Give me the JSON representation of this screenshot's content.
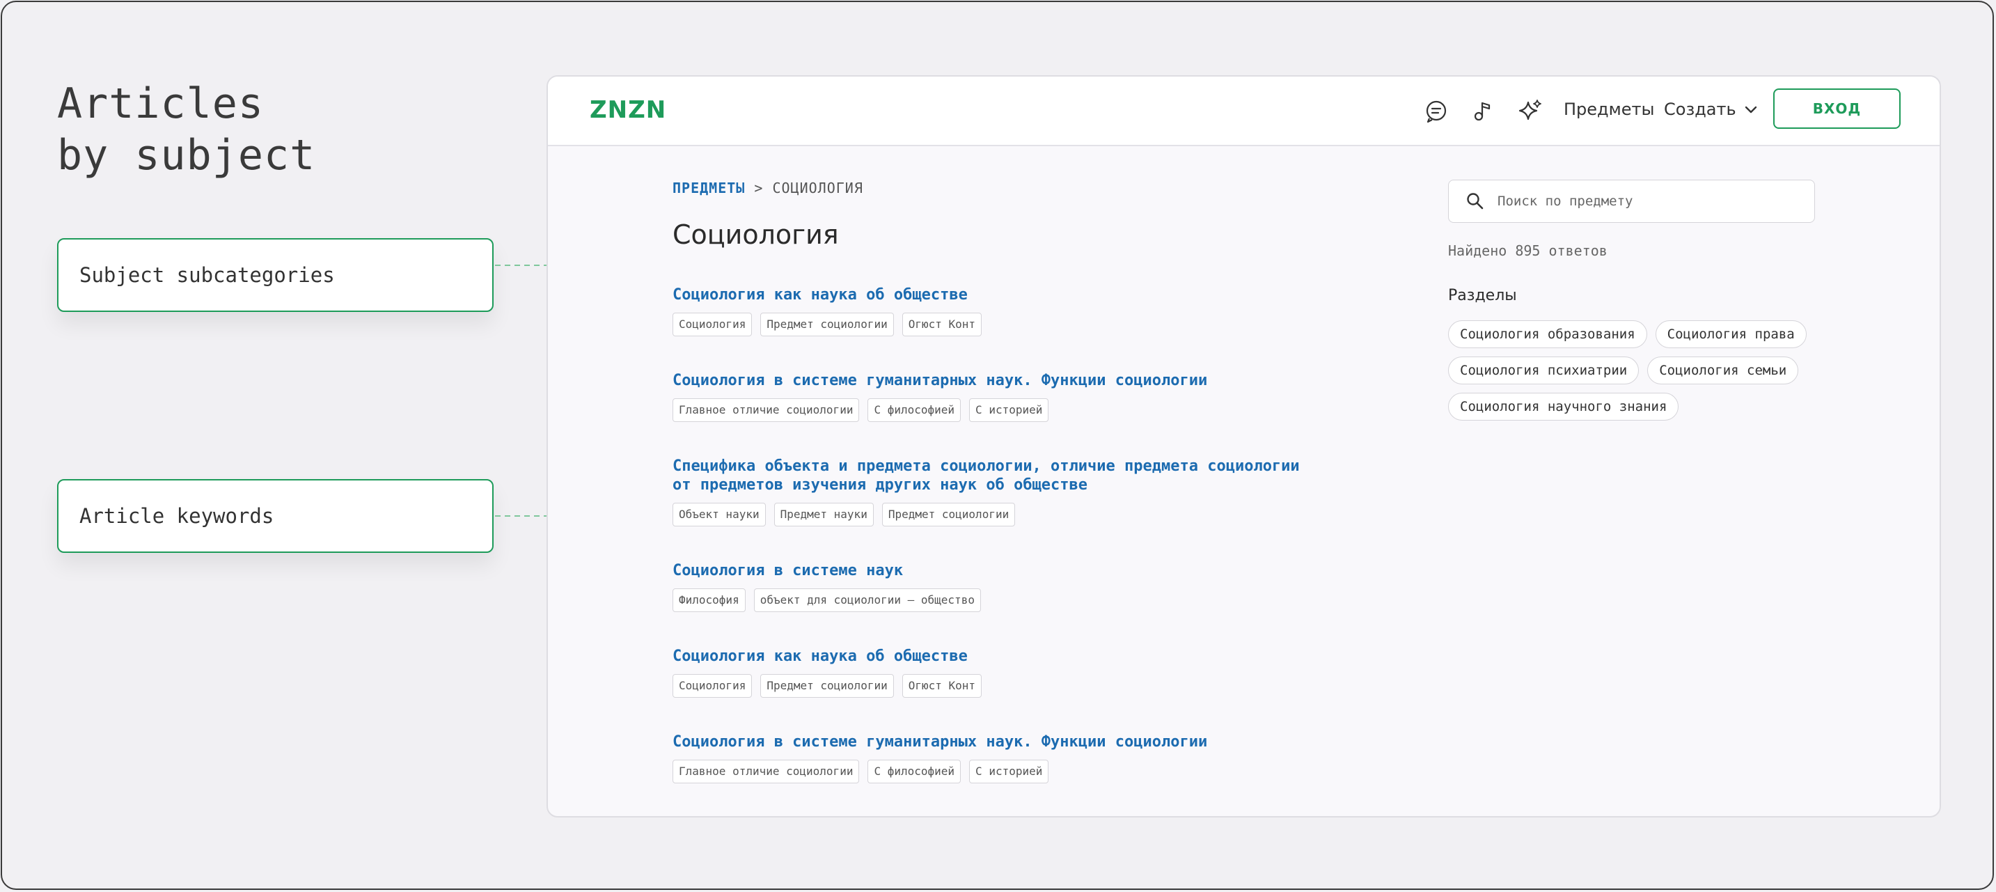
{
  "annotations": {
    "heading_line1": "Articles",
    "heading_line2": "by subject",
    "callout_subcategories": "Subject subcategories",
    "callout_keywords": "Article keywords"
  },
  "header": {
    "logo": "ZNZN",
    "icons": [
      "chat-icon",
      "music-note-icon",
      "sparkle-icon",
      "chevron-down-icon"
    ],
    "nav_subjects": "Предметы",
    "nav_create": "Создать",
    "login": "ВХОД"
  },
  "breadcrumb": {
    "link": "ПРЕДМЕТЫ",
    "separator": ">",
    "current": "СОЦИОЛОГИЯ"
  },
  "page_title": "Социология",
  "articles": [
    {
      "title": "Социология как наука об обществе",
      "tags": [
        "Социология",
        "Предмет социологии",
        "Огюст Конт"
      ]
    },
    {
      "title": "Социология в системе гуманитарных наук. Функции социологии",
      "tags": [
        "Главное отличие социологии",
        "С философией",
        "С историей"
      ]
    },
    {
      "title": "Специфика объекта и предмета социологии, отличие предмета социологии",
      "title2": "от предметов изучения других наук об обществе",
      "tags": [
        "Объект науки",
        "Предмет науки",
        "Предмет социологии"
      ]
    },
    {
      "title": "Социология в системе наук",
      "tags": [
        "Философия",
        "объект для социологии — общество"
      ]
    },
    {
      "title": "Социология как наука об обществе",
      "tags": [
        "Социология",
        "Предмет социологии",
        "Огюст Конт"
      ]
    },
    {
      "title": "Социология в системе гуманитарных наук. Функции социологии",
      "tags": [
        "Главное отличие социологии",
        "С философией",
        "С историей"
      ]
    }
  ],
  "sidebar": {
    "search_placeholder": "Поиск по предмету",
    "found_text": "Найдено 895 ответов",
    "sections_title": "Разделы",
    "sections": [
      "Социология образования",
      "Социология права",
      "Социология психиатрии",
      "Социология семьи",
      "Социология научного знания"
    ]
  },
  "colors": {
    "brand_green": "#1e9b5a",
    "link_blue": "#1c6bb0",
    "connector_green": "#7fc79c"
  }
}
